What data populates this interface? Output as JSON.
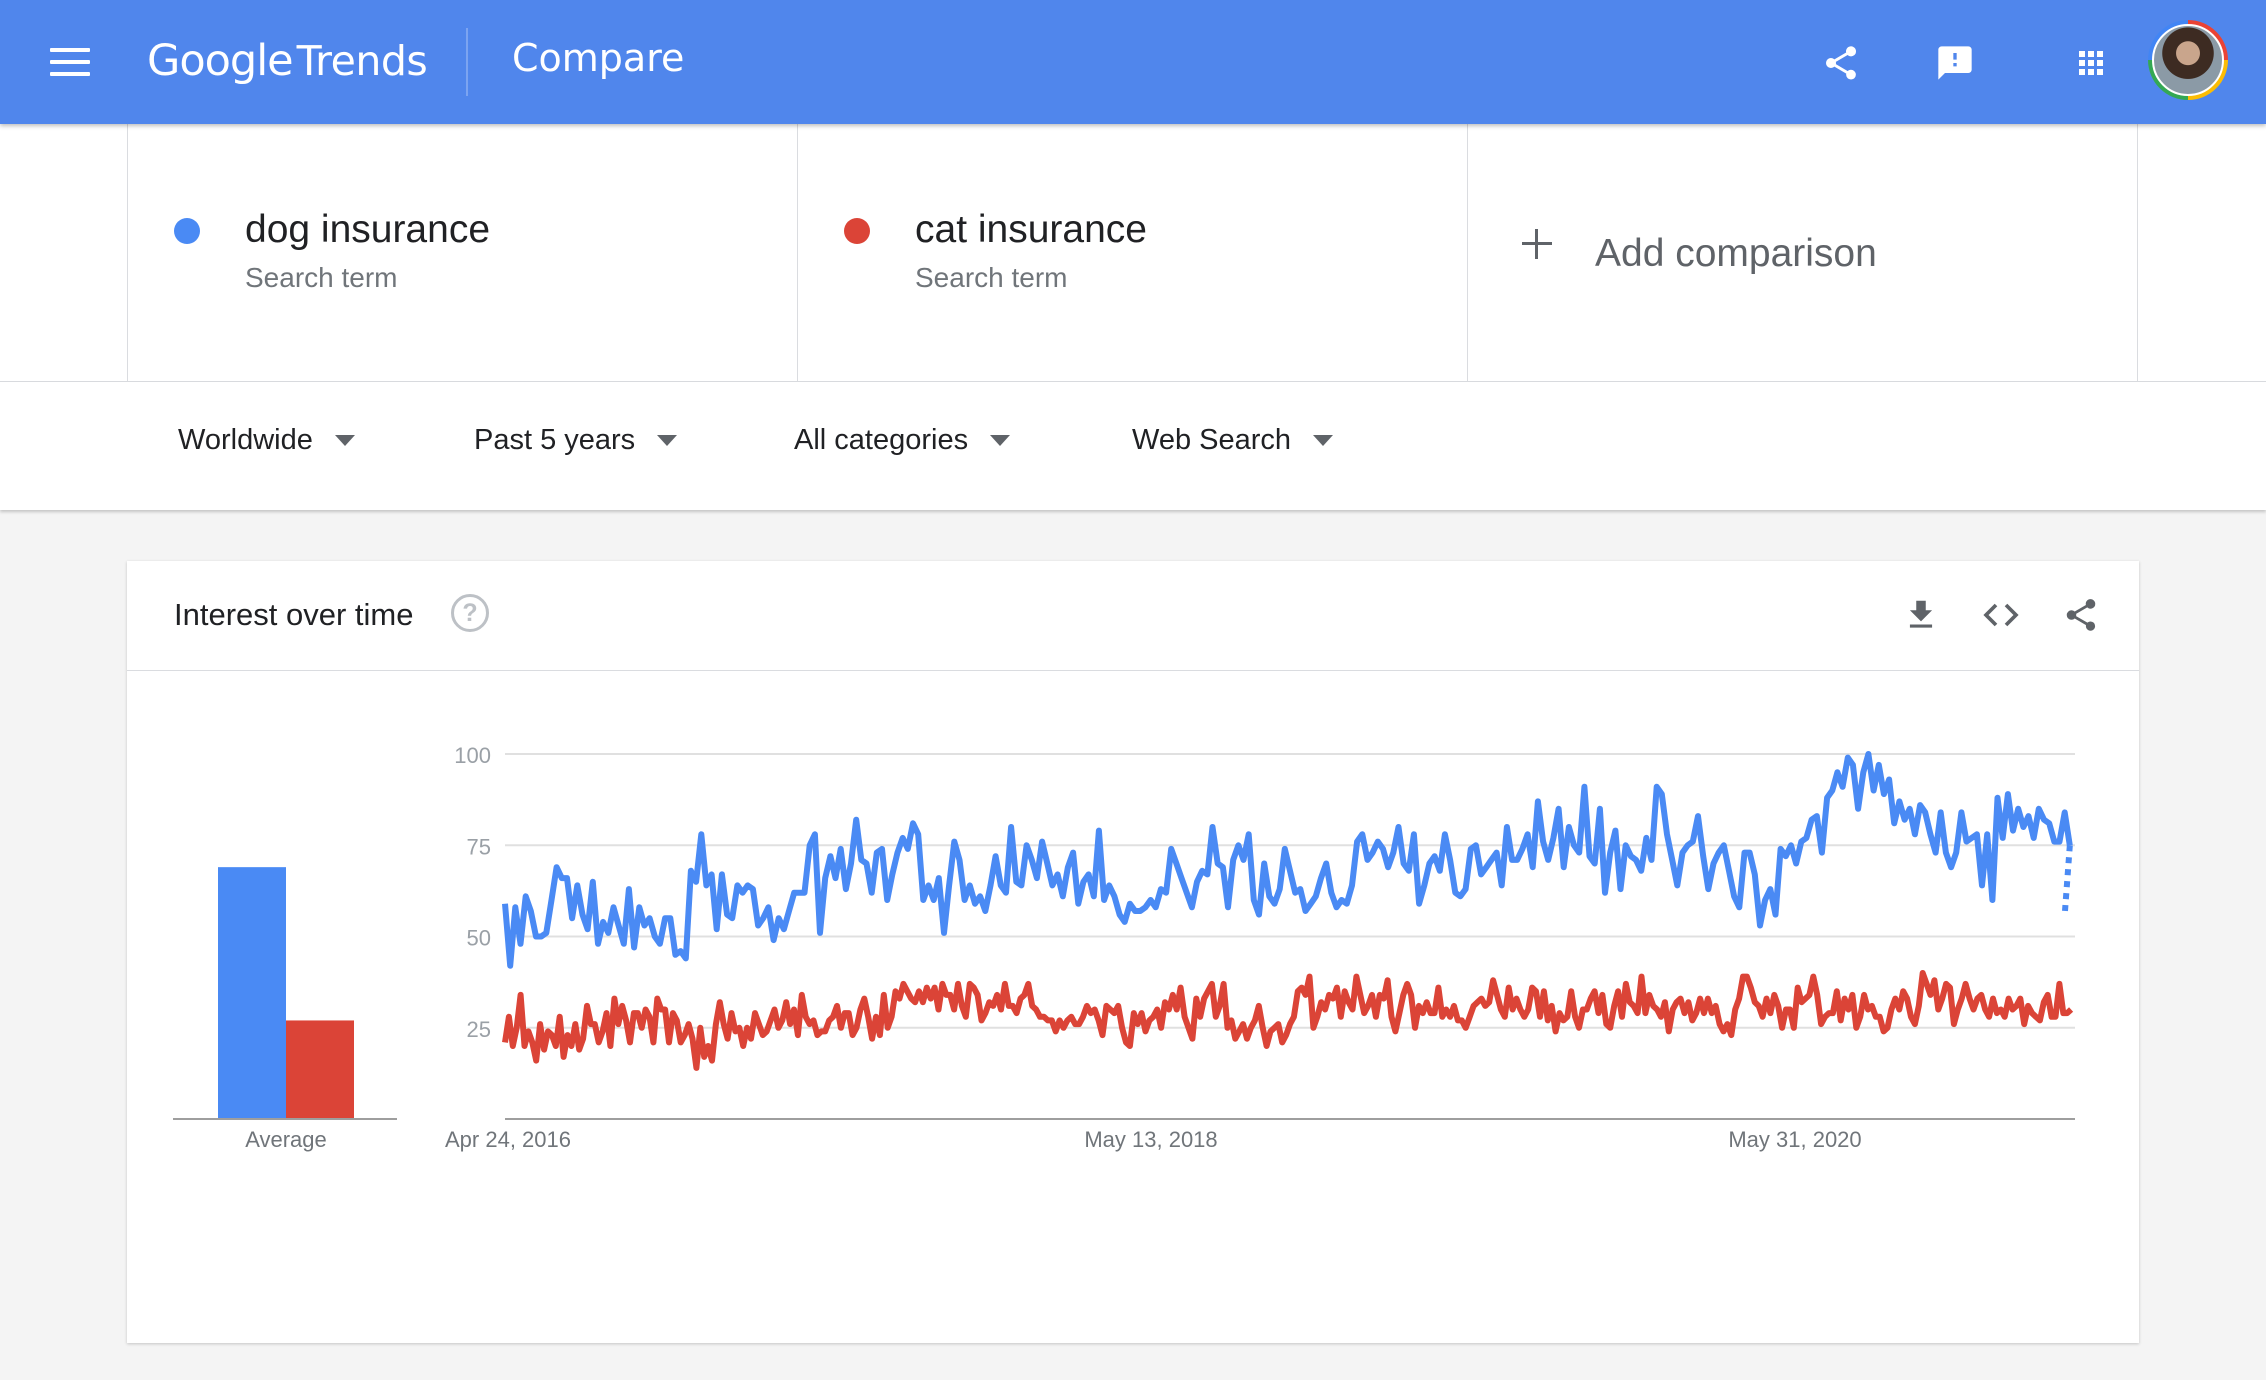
{
  "header": {
    "logo_google": "Google",
    "logo_trends": "Trends",
    "page_title": "Compare",
    "icons": [
      "menu-icon",
      "share-icon",
      "feedback-icon",
      "apps-icon",
      "avatar"
    ],
    "background_color": "#5086ec"
  },
  "terms": [
    {
      "name": "dog insurance",
      "subtitle": "Search term",
      "color": "#4a8af4"
    },
    {
      "name": "cat insurance",
      "subtitle": "Search term",
      "color": "#db4437"
    }
  ],
  "add_comparison": {
    "label": "Add comparison"
  },
  "filters": [
    {
      "label": "Worldwide"
    },
    {
      "label": "Past 5 years"
    },
    {
      "label": "All categories"
    },
    {
      "label": "Web Search"
    }
  ],
  "card": {
    "title": "Interest over time",
    "help_glyph": "?",
    "icons": [
      "download-icon",
      "embed-icon",
      "share-icon"
    ]
  },
  "chart_data": {
    "type": "line",
    "title": "",
    "y_ticks": [
      25,
      50,
      75,
      100
    ],
    "ylim": [
      0,
      100
    ],
    "x_tick_labels": [
      "Apr 24, 2016",
      "May 13, 2018",
      "May 31, 2020"
    ],
    "x_range": [
      "2016-04-24",
      "2021-04-18"
    ],
    "grid": true,
    "series": [
      {
        "name": "dog insurance",
        "color": "#4a8af4",
        "last_point_partial": true,
        "values": [
          59,
          42,
          58,
          48,
          61,
          57,
          50,
          50,
          51,
          60,
          69,
          66,
          66,
          55,
          64,
          56,
          52,
          65,
          48,
          54,
          51,
          58,
          53,
          48,
          63,
          47,
          58,
          53,
          55,
          50,
          48,
          55,
          55,
          45,
          46,
          44,
          68,
          65,
          78,
          64,
          67,
          52,
          67,
          56,
          55,
          64,
          62,
          64,
          63,
          53,
          55,
          58,
          49,
          55,
          52,
          57,
          62,
          62,
          62,
          75,
          78,
          51,
          66,
          72,
          66,
          74,
          63,
          70,
          82,
          71,
          70,
          62,
          73,
          74,
          60,
          67,
          73,
          77,
          74,
          81,
          78,
          60,
          64,
          60,
          66,
          51,
          64,
          76,
          71,
          60,
          64,
          59,
          61,
          57,
          64,
          72,
          64,
          62,
          80,
          65,
          64,
          75,
          71,
          66,
          76,
          70,
          64,
          67,
          61,
          69,
          73,
          59,
          65,
          67,
          61,
          79,
          60,
          64,
          61,
          56,
          54,
          59,
          57,
          57,
          58,
          60,
          58,
          63,
          62,
          74,
          70,
          66,
          62,
          58,
          65,
          68,
          67,
          80,
          70,
          69,
          58,
          71,
          75,
          71,
          78,
          60,
          56,
          70,
          61,
          59,
          63,
          74,
          68,
          62,
          63,
          57,
          59,
          61,
          66,
          70,
          62,
          58,
          60,
          59,
          64,
          76,
          78,
          71,
          73,
          76,
          74,
          69,
          73,
          80,
          70,
          68,
          78,
          59,
          64,
          70,
          72,
          68,
          78,
          71,
          62,
          61,
          63,
          74,
          75,
          67,
          69,
          71,
          73,
          64,
          80,
          71,
          71,
          74,
          78,
          69,
          87,
          76,
          71,
          77,
          85,
          69,
          80,
          75,
          73,
          91,
          72,
          70,
          85,
          62,
          73,
          79,
          63,
          75,
          72,
          71,
          68,
          77,
          71,
          91,
          89,
          78,
          71,
          64,
          73,
          75,
          76,
          83,
          72,
          63,
          70,
          73,
          75,
          68,
          61,
          58,
          73,
          73,
          67,
          53,
          60,
          63,
          56,
          74,
          72,
          75,
          70,
          76,
          77,
          82,
          83,
          73,
          88,
          90,
          95,
          91,
          99,
          97,
          85,
          95,
          100,
          90,
          97,
          89,
          93,
          81,
          87,
          82,
          85,
          78,
          86,
          84,
          78,
          73,
          84,
          73,
          69,
          73,
          84,
          76,
          77,
          78,
          64,
          78,
          60,
          88,
          77,
          89,
          79,
          85,
          80,
          83,
          77,
          85,
          82,
          81,
          76,
          76,
          84,
          75
        ],
        "projected_value": 57
      },
      {
        "name": "cat insurance",
        "color": "#db4437",
        "values": [
          21,
          28,
          20,
          25,
          34,
          20,
          24,
          21,
          16,
          26,
          19,
          24,
          23,
          20,
          28,
          17,
          23,
          20,
          26,
          19,
          22,
          31,
          26,
          26,
          21,
          24,
          29,
          20,
          33,
          26,
          31,
          27,
          21,
          29,
          29,
          25,
          30,
          28,
          21,
          33,
          30,
          30,
          21,
          29,
          27,
          21,
          23,
          26,
          22,
          14,
          25,
          17,
          20,
          16,
          26,
          32,
          26,
          22,
          29,
          24,
          25,
          20,
          25,
          22,
          29,
          26,
          23,
          24,
          27,
          30,
          25,
          27,
          32,
          26,
          30,
          23,
          34,
          28,
          26,
          27,
          23,
          24,
          24,
          27,
          28,
          31,
          25,
          29,
          29,
          23,
          25,
          30,
          33,
          28,
          22,
          28,
          23,
          34,
          25,
          28,
          35,
          33,
          37,
          35,
          33,
          32,
          35,
          32,
          36,
          33,
          36,
          30,
          37,
          34,
          34,
          30,
          37,
          31,
          28,
          37,
          36,
          34,
          27,
          29,
          32,
          31,
          34,
          30,
          37,
          31,
          31,
          29,
          33,
          34,
          37,
          31,
          30,
          28,
          28,
          27,
          27,
          24,
          27,
          25,
          27,
          28,
          26,
          26,
          28,
          31,
          29,
          30,
          27,
          23,
          31,
          30,
          29,
          31,
          25,
          21,
          20,
          29,
          26,
          29,
          24,
          27,
          28,
          30,
          25,
          32,
          30,
          34,
          30,
          36,
          28,
          25,
          22,
          33,
          28,
          33,
          35,
          37,
          28,
          31,
          37,
          25,
          27,
          22,
          24,
          26,
          22,
          25,
          27,
          31,
          25,
          20,
          24,
          25,
          26,
          21,
          23,
          26,
          28,
          35,
          36,
          34,
          39,
          25,
          28,
          32,
          30,
          34,
          33,
          36,
          28,
          35,
          32,
          30,
          39,
          34,
          29,
          31,
          34,
          28,
          34,
          33,
          38,
          28,
          24,
          29,
          34,
          37,
          34,
          25,
          31,
          29,
          32,
          29,
          29,
          36,
          28,
          30,
          28,
          31,
          27,
          27,
          25,
          28,
          31,
          32,
          33,
          31,
          32,
          38,
          34,
          30,
          28,
          36,
          30,
          33,
          30,
          28,
          30,
          36,
          35,
          28,
          35,
          27,
          31,
          24,
          29,
          27,
          28,
          35,
          28,
          25,
          30,
          30,
          33,
          35,
          29,
          34,
          26,
          25,
          31,
          35,
          28,
          37,
          32,
          31,
          29,
          39,
          29,
          34,
          31,
          30,
          28,
          32,
          24,
          30,
          32,
          33,
          29,
          32,
          27,
          29,
          33,
          29,
          33,
          29,
          31,
          26,
          24,
          26,
          23,
          30,
          33,
          39,
          39,
          36,
          32,
          31,
          28,
          33,
          29,
          34,
          31,
          25,
          30,
          30,
          25,
          36,
          32,
          33,
          34,
          39,
          34,
          26,
          28,
          29,
          29,
          35,
          27,
          33,
          30,
          34,
          25,
          28,
          34,
          30,
          31,
          28,
          28,
          24,
          25,
          30,
          33,
          30,
          35,
          33,
          28,
          26,
          31,
          40,
          37,
          34,
          38,
          30,
          33,
          37,
          36,
          26,
          30,
          33,
          37,
          33,
          30,
          33,
          34,
          30,
          28,
          33,
          29,
          30,
          28,
          33,
          30,
          31,
          33,
          26,
          31,
          29,
          28,
          27,
          32,
          34,
          28,
          28,
          37,
          29,
          29,
          30
        ]
      }
    ],
    "averages": {
      "label": "Average",
      "values": [
        69,
        27
      ]
    }
  }
}
